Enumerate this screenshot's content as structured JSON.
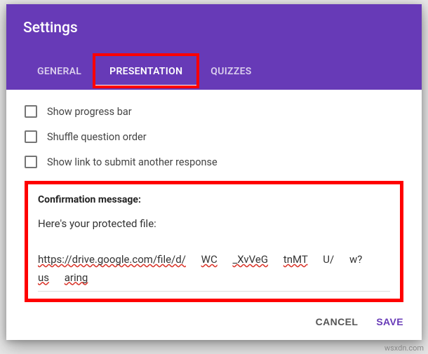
{
  "title": "Settings",
  "tabs": {
    "general": "GENERAL",
    "presentation": "PRESENTATION",
    "quizzes": "QUIZZES"
  },
  "options": {
    "progress": "Show progress bar",
    "shuffle": "Shuffle question order",
    "showlink": "Show link to submit another response"
  },
  "confirm": {
    "label": "Confirmation message:",
    "line1": "Here's your protected file:",
    "url_a": "https://drive.google.com/file/d/",
    "url_b": "WC",
    "url_c": "_XvVeG",
    "url_d": "tnMT",
    "url_e": "U/",
    "url_f": "w?",
    "url_g": "us",
    "url_h": "aring"
  },
  "buttons": {
    "cancel": "CANCEL",
    "save": "SAVE"
  },
  "watermark": "wsxdn.com"
}
